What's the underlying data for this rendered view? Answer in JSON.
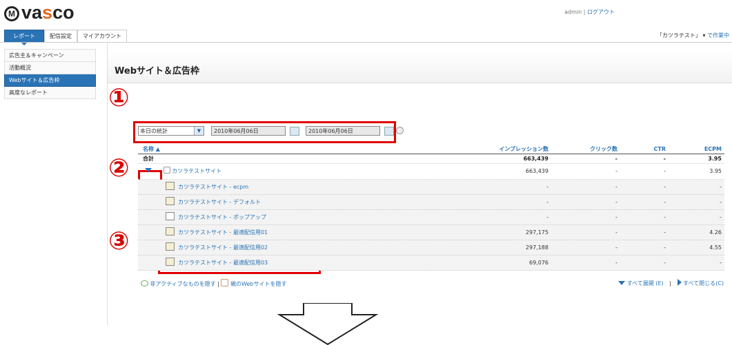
{
  "brand": {
    "prefix": "va",
    "accent": "s",
    "suffix": "co"
  },
  "userbar": {
    "user": "admin",
    "sep": "|",
    "logout": "ログアウト"
  },
  "tabs": [
    {
      "label": "レポート"
    },
    {
      "label": "配信設定"
    },
    {
      "label": "マイアカウント"
    }
  ],
  "project": {
    "name": "「カツラテスト」",
    "arrow": "▾",
    "action": "で作業中"
  },
  "sidebar": {
    "items": [
      {
        "label": "広告主＆キャンペーン"
      },
      {
        "label": "活動概況"
      },
      {
        "label": "Webサイト＆広告枠"
      },
      {
        "label": "高度なレポート"
      }
    ]
  },
  "page_title": "Webサイト＆広告枠",
  "markers": {
    "one": "①",
    "two": "②",
    "three": "③"
  },
  "filter": {
    "period": "本日の統計",
    "date_from": "2010年06月06日",
    "date_to": "2010年06月06日"
  },
  "table": {
    "headers": {
      "name": "名称 ▲",
      "impressions": "インプレッション数",
      "clicks": "クリック数",
      "ctr": "CTR",
      "ecpm": "ECPM"
    },
    "total": {
      "name": "合計",
      "impressions": "663,439",
      "clicks": "-",
      "ctr": "-",
      "ecpm": "3.95"
    },
    "site": {
      "name": "カツラテストサイト",
      "impressions": "663,439",
      "clicks": "-",
      "ctr": "-",
      "ecpm": "3.95"
    },
    "zones": [
      {
        "name": "カツラテストサイト - ecpm",
        "impressions": "-",
        "clicks": "-",
        "ctr": "-",
        "ecpm": "-"
      },
      {
        "name": "カツラテストサイト - デフォルト",
        "impressions": "-",
        "clicks": "-",
        "ctr": "-",
        "ecpm": "-"
      },
      {
        "name": "カツラテストサイト - ポップアップ",
        "impressions": "-",
        "clicks": "-",
        "ctr": "-",
        "ecpm": "-"
      },
      {
        "name": "カツラテストサイト - 最適配信用01",
        "impressions": "297,175",
        "clicks": "-",
        "ctr": "-",
        "ecpm": "4.26"
      },
      {
        "name": "カツラテストサイト - 最適配信用02",
        "impressions": "297,188",
        "clicks": "-",
        "ctr": "-",
        "ecpm": "4.55"
      },
      {
        "name": "カツラテストサイト - 最適配信用03",
        "impressions": "69,076",
        "clicks": "-",
        "ctr": "-",
        "ecpm": "-"
      }
    ]
  },
  "footer": {
    "hide_inactive": "非アクティブなものを隠す",
    "sep": "|",
    "hide_parent": "親のWebサイトを隠す",
    "expand_all": "すべて展開 (E)",
    "collapse_all": "すべて閉じる(C)"
  },
  "colors": {
    "accent": "#2a73b5",
    "brand_orange": "#e36a1e",
    "highlight_red": "#e00000"
  }
}
